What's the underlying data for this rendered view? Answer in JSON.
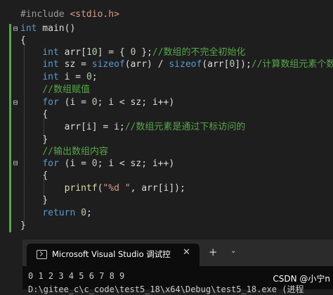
{
  "code": {
    "l1": {
      "a": "#include ",
      "b": "<stdio.h>"
    },
    "l2": {
      "kw": "int",
      "rest": " main()"
    },
    "l3": {
      "t": "{"
    },
    "l4": {
      "kw": "int",
      "a": " arr[",
      "n": "10",
      "b": "] = { ",
      "z": "0",
      "c": " };",
      "cm": "//数组的不完全初始化"
    },
    "l5": {
      "kw": "int",
      "a": " sz = ",
      "kw2": "sizeof",
      "b": "(arr) / ",
      "kw3": "sizeof",
      "c": "(arr[",
      "z": "0",
      "d": "]);",
      "cm": "//计算数组元素个数"
    },
    "l6": {
      "kw": "int",
      "a": " i = ",
      "z": "0",
      "b": ";"
    },
    "l7": {
      "cm": "//数组赋值"
    },
    "l8": {
      "kw": "for",
      "a": " (i = ",
      "z": "0",
      "b": "; i < sz; i++)"
    },
    "l9": {
      "t": "{"
    },
    "l10": {
      "a": "arr[i] = i;",
      "cm": "//数组元素是通过下标访问的"
    },
    "l11": {
      "t": "}"
    },
    "l12": {
      "cm": "//输出数组内容"
    },
    "l13": {
      "kw": "for",
      "a": " (i = ",
      "z": "0",
      "b": "; i < sz; i++)"
    },
    "l14": {
      "t": "{"
    },
    "l15": {
      "fn": "printf",
      "a": "(",
      "s": "\"%d \"",
      "b": ", arr[i]);"
    },
    "l16": {
      "t": "}"
    },
    "l17": {
      "kw": "return",
      "a": " ",
      "z": "0",
      "b": ";"
    },
    "l18": {
      "t": "}"
    }
  },
  "fold_icons": {
    "main": "⊟",
    "for1": "⊟",
    "for2": "⊟"
  },
  "console": {
    "tab_title": "Microsoft Visual Studio 调试控",
    "tab_close": "✕",
    "new_tab": "+",
    "dropdown": "⌄",
    "output_line1": "0 1 2 3 4 5 6 7 8 9",
    "output_line2": "D:\\gitee_c\\c_code\\test5_18\\x64\\Debug\\test5_18.exe (进程"
  },
  "watermark": "CSDN @小宁n"
}
